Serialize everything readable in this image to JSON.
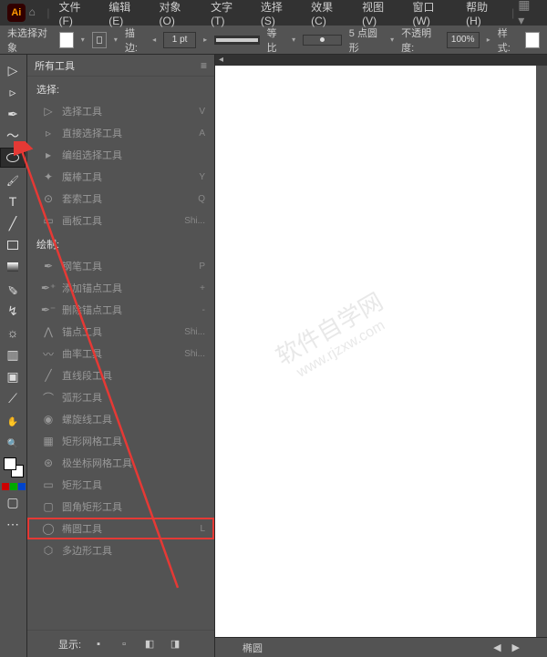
{
  "menubar": {
    "logo": "Ai",
    "items": [
      "文件(F)",
      "编辑(E)",
      "对象(O)",
      "文字(T)",
      "选择(S)",
      "效果(C)",
      "视图(V)",
      "窗口(W)",
      "帮助(H)"
    ]
  },
  "controlbar": {
    "no_selection": "未选择对象",
    "stroke_label": "描边:",
    "stroke_width": "1 pt",
    "uniform": "等比",
    "brush_pt": "5 点圆形",
    "opacity_label": "不透明度:",
    "opacity": "100%",
    "style_label": "样式:"
  },
  "panel": {
    "title": "所有工具",
    "section_select": "选择:",
    "section_draw": "绘制:",
    "selection_tools": [
      {
        "icon": "▷",
        "label": "选择工具",
        "shortcut": "V"
      },
      {
        "icon": "▹",
        "label": "直接选择工具",
        "shortcut": "A"
      },
      {
        "icon": "▸",
        "label": "编组选择工具",
        "shortcut": ""
      },
      {
        "icon": "✦",
        "label": "魔棒工具",
        "shortcut": "Y"
      },
      {
        "icon": "⊙",
        "label": "套索工具",
        "shortcut": "Q"
      },
      {
        "icon": "▭",
        "label": "画板工具",
        "shortcut": "Shi..."
      }
    ],
    "draw_tools": [
      {
        "icon": "✒",
        "label": "钢笔工具",
        "shortcut": "P"
      },
      {
        "icon": "✒⁺",
        "label": "添加锚点工具",
        "shortcut": "+"
      },
      {
        "icon": "✒⁻",
        "label": "删除锚点工具",
        "shortcut": "-"
      },
      {
        "icon": "⋀",
        "label": "锚点工具",
        "shortcut": "Shi..."
      },
      {
        "icon": "〰",
        "label": "曲率工具",
        "shortcut": "Shi..."
      },
      {
        "icon": "╱",
        "label": "直线段工具",
        "shortcut": ""
      },
      {
        "icon": "⌒",
        "label": "弧形工具",
        "shortcut": ""
      },
      {
        "icon": "◉",
        "label": "螺旋线工具",
        "shortcut": ""
      },
      {
        "icon": "▦",
        "label": "矩形网格工具",
        "shortcut": ""
      },
      {
        "icon": "⊛",
        "label": "极坐标网格工具",
        "shortcut": ""
      },
      {
        "icon": "▭",
        "label": "矩形工具",
        "shortcut": ""
      },
      {
        "icon": "▢",
        "label": "圆角矩形工具",
        "shortcut": ""
      },
      {
        "icon": "◯",
        "label": "椭圆工具",
        "shortcut": "L",
        "highlight": true
      },
      {
        "icon": "⬡",
        "label": "多边形工具",
        "shortcut": ""
      }
    ],
    "footer_label": "显示:"
  },
  "canvas_footer": {
    "label": "椭圆"
  },
  "watermark": {
    "line1": "软件自学网",
    "line2": "www.rjzxw.com"
  }
}
